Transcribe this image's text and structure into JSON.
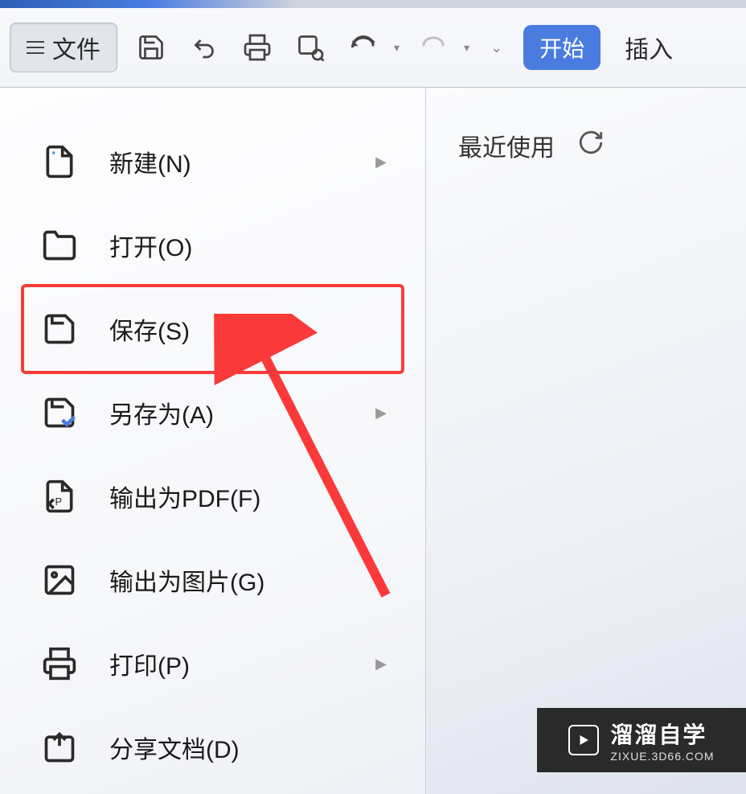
{
  "toolbar": {
    "file_label": "文件",
    "start_label": "开始",
    "insert_label": "插入"
  },
  "menu": {
    "items": [
      {
        "label": "新建(N)",
        "icon": "new-doc-icon",
        "has_submenu": true
      },
      {
        "label": "打开(O)",
        "icon": "folder-icon",
        "has_submenu": false
      },
      {
        "label": "保存(S)",
        "icon": "save-icon",
        "has_submenu": false,
        "highlighted": true
      },
      {
        "label": "另存为(A)",
        "icon": "save-as-icon",
        "has_submenu": true
      },
      {
        "label": "输出为PDF(F)",
        "icon": "pdf-icon",
        "has_submenu": false
      },
      {
        "label": "输出为图片(G)",
        "icon": "image-icon",
        "has_submenu": false
      },
      {
        "label": "打印(P)",
        "icon": "print-icon",
        "has_submenu": true
      },
      {
        "label": "分享文档(D)",
        "icon": "share-icon",
        "has_submenu": false
      }
    ]
  },
  "right_panel": {
    "recent_label": "最近使用"
  },
  "watermark": {
    "title": "溜溜自学",
    "subtitle": "ZIXUE.3D66.COM"
  },
  "annotation": {
    "highlight_color": "#fa3a3a"
  }
}
